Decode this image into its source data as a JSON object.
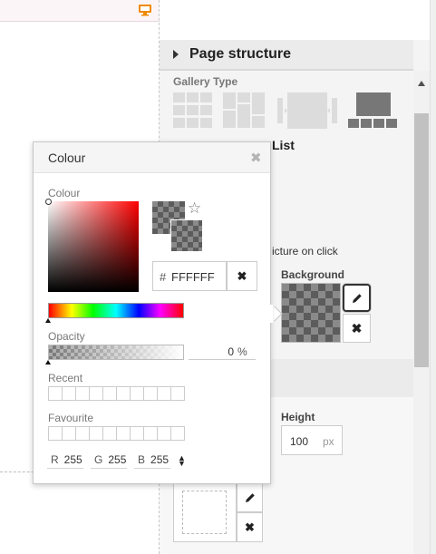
{
  "page_structure": {
    "title": "Page structure",
    "gallery_type_label": "Gallery Type",
    "list_label": "List",
    "picture_on_click_text": "icture on click"
  },
  "background": {
    "label": "Background"
  },
  "height": {
    "label": "Height",
    "value": "100",
    "unit": "px"
  },
  "colour_popup": {
    "title": "Colour",
    "close_glyph": "✖",
    "colour_label": "Colour",
    "hex_prefix": "#",
    "hex_value": "FFFFFF",
    "clear_glyph": "✖",
    "star_glyph": "☆",
    "opacity_label": "Opacity",
    "opacity_value": "0",
    "opacity_unit": "%",
    "recent_label": "Recent",
    "favourite_label": "Favourite",
    "r_label": "R",
    "r_value": "255",
    "g_label": "G",
    "g_value": "255",
    "b_label": "B",
    "b_value": "255",
    "mode_toggle_glyph": "▲▼"
  },
  "colors": {
    "accent_orange": "#f08a00",
    "scroll_thumb": "#c1c1c1"
  },
  "icons": {
    "monitor": "desktop-monitor-icon",
    "pencil": "pencil-icon",
    "close": "close-x-icon",
    "star": "star-outline-icon"
  }
}
